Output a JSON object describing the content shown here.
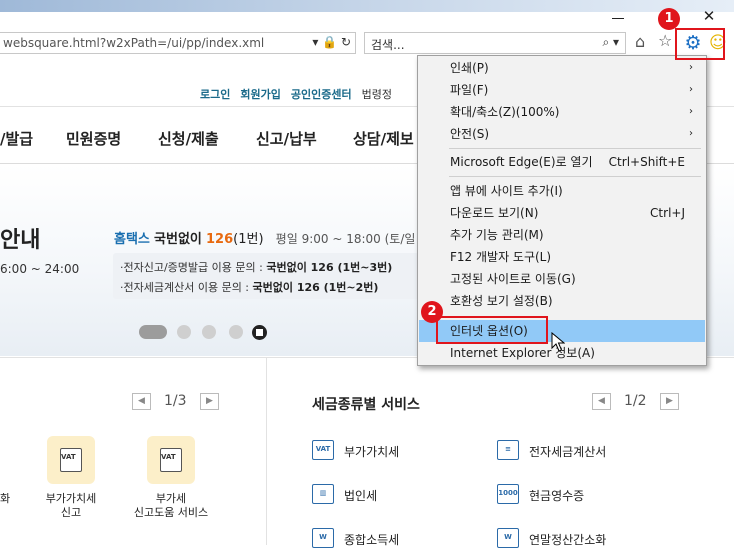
{
  "browser": {
    "address_url": "websquare.html?w2xPath=/ui/pp/index.xml",
    "address_tools": "▾ 🔒 ↻",
    "search_placeholder": "검색...",
    "search_tools": "⌕ ▾",
    "close_glyph": "✕",
    "home_glyph": "⌂",
    "star_glyph": "☆",
    "gear_glyph": "⚙",
    "smiley_glyph": "☺"
  },
  "annotations": {
    "badge1": "1",
    "badge2": "2"
  },
  "top_links": [
    "로그인",
    "회원가입",
    "공인인증센터",
    "법령정"
  ],
  "gnb": [
    "/발급",
    "민원증명",
    "신청/제출",
    "신고/납부",
    "상담/제보"
  ],
  "hero": {
    "guide_title": "안내",
    "guide_hours": "6:00 ~ 24:00",
    "hometax": "홈택스",
    "call_prefix": "국번없이",
    "call_number": "126",
    "call_suffix": "(1번)",
    "hours": "평일 9:00 ~ 18:00 (토/일",
    "inquiry1_prefix": "·전자신고/증명발급 이용 문의 : ",
    "inquiry1_value": "국번없이 126 (1번~3번)",
    "inquiry2_prefix": "·전자세금계산서 이용 문의 : ",
    "inquiry2_value": "국번없이 126 (1번~2번)"
  },
  "left_pager": "1/3",
  "right_pager": "1/2",
  "tax_section_title": "세금종류별 서비스",
  "left_services": [
    {
      "label": "화"
    },
    {
      "label": "부가가치세\n신고",
      "icon_text": "VAT"
    },
    {
      "label": "부가세\n신고도움 서비스",
      "icon_text": "VAT"
    }
  ],
  "tax_services": [
    {
      "label": "부가가치세",
      "icon_text": "VAT"
    },
    {
      "label": "전자세금계산서",
      "icon_text": "≡"
    },
    {
      "label": "법인세",
      "icon_text": "▥"
    },
    {
      "label": "현금영수증",
      "icon_text": "1000"
    },
    {
      "label": "종합소득세",
      "icon_text": "W"
    },
    {
      "label": "연말정산간소화",
      "icon_text": "W"
    }
  ],
  "menu": {
    "items": [
      {
        "label": "인쇄(P)",
        "arrow": "›"
      },
      {
        "label": "파일(F)",
        "arrow": "›"
      },
      {
        "label": "확대/축소(Z)(100%)",
        "arrow": "›"
      },
      {
        "label": "안전(S)",
        "arrow": "›"
      },
      {
        "label": "Microsoft Edge(E)로 열기",
        "shortcut": "Ctrl+Shift+E"
      },
      {
        "label": "앱 뷰에 사이트 추가(I)"
      },
      {
        "label": "다운로드 보기(N)",
        "shortcut": "Ctrl+J"
      },
      {
        "label": "추가 기능 관리(M)"
      },
      {
        "label": "F12 개발자 도구(L)"
      },
      {
        "label": "고정된 사이트로 이동(G)"
      },
      {
        "label": "호환성 보기 설정(B)"
      },
      {
        "label": "인터넷 옵션(O)"
      },
      {
        "label": "Internet Explorer 정보(A)"
      }
    ]
  },
  "colors": {
    "accent_red": "#e0151c",
    "menu_highlight": "#91c9f7",
    "gear_blue": "#1c6fc4"
  }
}
